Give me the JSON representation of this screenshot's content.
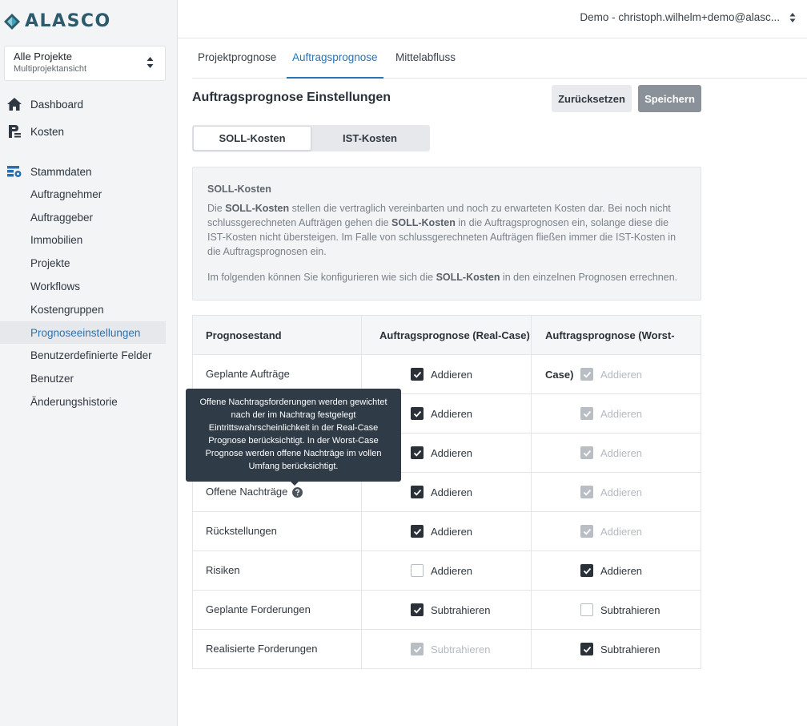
{
  "logo": {
    "text": "ALASCO"
  },
  "project_select": {
    "title": "Alle Projekte",
    "subtitle": "Multiprojektansicht"
  },
  "nav": {
    "dashboard": "Dashboard",
    "kosten": "Kosten",
    "stammdaten": "Stammdaten",
    "sub_items": [
      "Auftragnehmer",
      "Auftraggeber",
      "Immobilien",
      "Projekte",
      "Workflows",
      "Kostengruppen",
      "Prognoseeinstellungen",
      "Benutzerdefinierte Felder",
      "Benutzer",
      "Änderungshistorie"
    ],
    "active_item": "Prognoseeinstellungen"
  },
  "user": {
    "label": "Demo - christoph.wilhelm+demo@alasc..."
  },
  "tabs": [
    "Projektprognose",
    "Auftragsprognose",
    "Mittelabfluss"
  ],
  "active_tab": "Auftragsprognose",
  "page": {
    "title": "Auftragsprognose Einstellungen",
    "reset_label": "Zurücksetzen",
    "save_label": "Speichern"
  },
  "toggle": {
    "soll": "SOLL-Kosten",
    "ist": "IST-Kosten",
    "active": "SOLL-Kosten"
  },
  "info": {
    "title": "SOLL-Kosten",
    "p1_a": "Die ",
    "p1_b": "SOLL-Kosten",
    "p1_c": " stellen die vertraglich vereinbarten und noch zu erwarteten Kosten dar. Bei noch nicht schlussgerechneten Aufträgen gehen die ",
    "p1_d": "SOLL-Kosten",
    "p1_e": " in die Auftragsprognosen ein, solange diese die IST-Kosten nicht übersteigen. Im Falle von schlussgerechneten Aufträgen fließen immer die IST-Kosten in die Auftragsprognosen ein.",
    "p2_a": "Im folgenden können Sie konfigurieren wie sich die ",
    "p2_b": "SOLL-Kosten",
    "p2_c": " in den einzelnen Prognosen errechnen."
  },
  "table": {
    "headers": [
      "Prognosestand",
      "Auftragsprognose (Real-Case)",
      "Auftragsprognose (Worst-Case)"
    ],
    "rows": [
      {
        "label": "Geplante Aufträge",
        "real": {
          "label": "Addieren",
          "state": "on"
        },
        "worst": {
          "label": "Addieren",
          "state": "dis"
        }
      },
      {
        "label": "",
        "real": {
          "label": "Addieren",
          "state": "on"
        },
        "worst": {
          "label": "Addieren",
          "state": "dis"
        }
      },
      {
        "label": "",
        "real": {
          "label": "Addieren",
          "state": "on"
        },
        "worst": {
          "label": "Addieren",
          "state": "dis"
        }
      },
      {
        "label": "Offene Nachträge",
        "real": {
          "label": "Addieren",
          "state": "on"
        },
        "worst": {
          "label": "Addieren",
          "state": "dis"
        },
        "help": true
      },
      {
        "label": "Rückstellungen",
        "real": {
          "label": "Addieren",
          "state": "on"
        },
        "worst": {
          "label": "Addieren",
          "state": "dis"
        }
      },
      {
        "label": "Risiken",
        "real": {
          "label": "Addieren",
          "state": "off"
        },
        "worst": {
          "label": "Addieren",
          "state": "on"
        }
      },
      {
        "label": "Geplante Forderungen",
        "real": {
          "label": "Subtrahieren",
          "state": "on"
        },
        "worst": {
          "label": "Subtrahieren",
          "state": "off"
        }
      },
      {
        "label": "Realisierte Forderungen",
        "real": {
          "label": "Subtrahieren",
          "state": "dis"
        },
        "worst": {
          "label": "Subtrahieren",
          "state": "on"
        }
      }
    ]
  },
  "tooltip": {
    "lines": [
      "Offene Nachtragsforderungen werden gewichtet",
      "nach der im Nachtrag festgelegt",
      "Eintrittswahrscheinlichkeit in der Real-Case",
      "Prognose berücksichtigt. In der Worst-Case",
      "Prognose werden offene Nachträge im vollen",
      "Umfang berücksichtigt."
    ]
  },
  "colors": {
    "accent": "#2a73b6",
    "brand": "#2c5b6e",
    "tooltip_bg": "#2f3b47",
    "sidebar_bg": "#f3f4f5"
  },
  "icons": {
    "logo": "alasco-logo-icon",
    "dashboard": "home-icon",
    "kosten": "cost-icon",
    "stammdaten": "master-data-icon",
    "help": "question-circle-icon",
    "select": "updown-caret-icon"
  }
}
